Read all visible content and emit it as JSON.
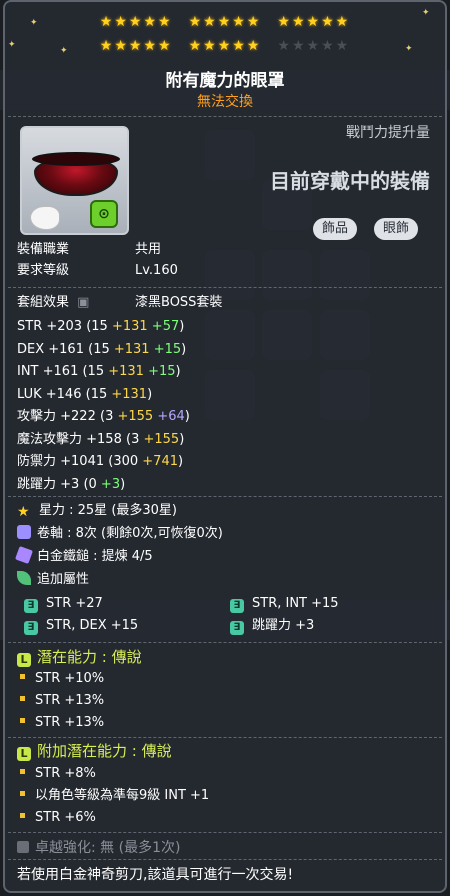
{
  "stars": {
    "filled": 25,
    "total": 30
  },
  "header": {
    "item_name": "附有魔力的眼罩",
    "trade_note": "無法交換"
  },
  "compare": {
    "power_label": "戰鬥力提升量",
    "wearing_label": "目前穿戴中的裝備"
  },
  "tags": {
    "accessory": "飾品",
    "eye": "眼飾"
  },
  "info": {
    "job_label": "裝備職業",
    "job_value": "共用",
    "level_label": "要求等級",
    "level_value": "Lv.160",
    "set_label": "套組效果",
    "set_value": "漆黑BOSS套裝"
  },
  "stats": [
    {
      "name": "STR",
      "total": "+203",
      "base": "(15",
      "scroll": "+131",
      "bonus": "+57",
      "bonus_color": "green"
    },
    {
      "name": "DEX",
      "total": "+161",
      "base": "(15",
      "scroll": "+131",
      "bonus": "+15",
      "bonus_color": "green"
    },
    {
      "name": "INT",
      "total": "+161",
      "base": "(15",
      "scroll": "+131",
      "bonus": "+15",
      "bonus_color": "green"
    },
    {
      "name": "LUK",
      "total": "+146",
      "base": "(15",
      "scroll": "+131",
      "bonus": "",
      "bonus_color": ""
    },
    {
      "name": "攻擊力",
      "total": "+222",
      "base": "(3",
      "scroll": "+155",
      "bonus": "+64",
      "bonus_color": "purple"
    },
    {
      "name": "魔法攻擊力",
      "total": "+158",
      "base": "(3",
      "scroll": "+155",
      "bonus": "",
      "bonus_color": ""
    },
    {
      "name": "防禦力",
      "total": "+1041",
      "base": "(300",
      "scroll": "+741",
      "bonus": "",
      "bonus_color": ""
    },
    {
      "name": "跳躍力",
      "total": "+3",
      "base": "(0",
      "scroll": "",
      "bonus": "+3",
      "bonus_color": "green"
    }
  ],
  "enhance": {
    "starforce": "星力 : 25星 (最多30星)",
    "scroll": "卷軸 : 8次 (剩餘0次,可恢復0次)",
    "hammer": "白金鐵鎚 : 提煉 4/5",
    "additional": "追加屬性"
  },
  "additional_options": [
    {
      "text": "STR  +27"
    },
    {
      "text": "STR, INT  +15"
    },
    {
      "text": "STR, DEX  +15"
    },
    {
      "text": "跳躍力 +3"
    }
  ],
  "potential": {
    "badge": "L",
    "title": "潛在能力 : 傳說",
    "lines": [
      "STR +10%",
      "STR +13%",
      "STR +13%"
    ]
  },
  "bonus_potential": {
    "badge": "L",
    "title": "附加潛在能力 : 傳說",
    "lines": [
      "STR +8%",
      "以角色等級為準每9級 INT +1",
      "STR +6%"
    ]
  },
  "exceptional": "卓越強化: 無 (最多1次)",
  "footer": "若使用白金神奇剪刀,該道具可進行一次交易!",
  "colors": {
    "title": "#ffffff",
    "trade": "#ff9f1c",
    "star": "#ffd21f",
    "scroll_bonus": "#ffd84a",
    "flame_bonus": "#7dff7a",
    "potential": "#d7ee52"
  }
}
